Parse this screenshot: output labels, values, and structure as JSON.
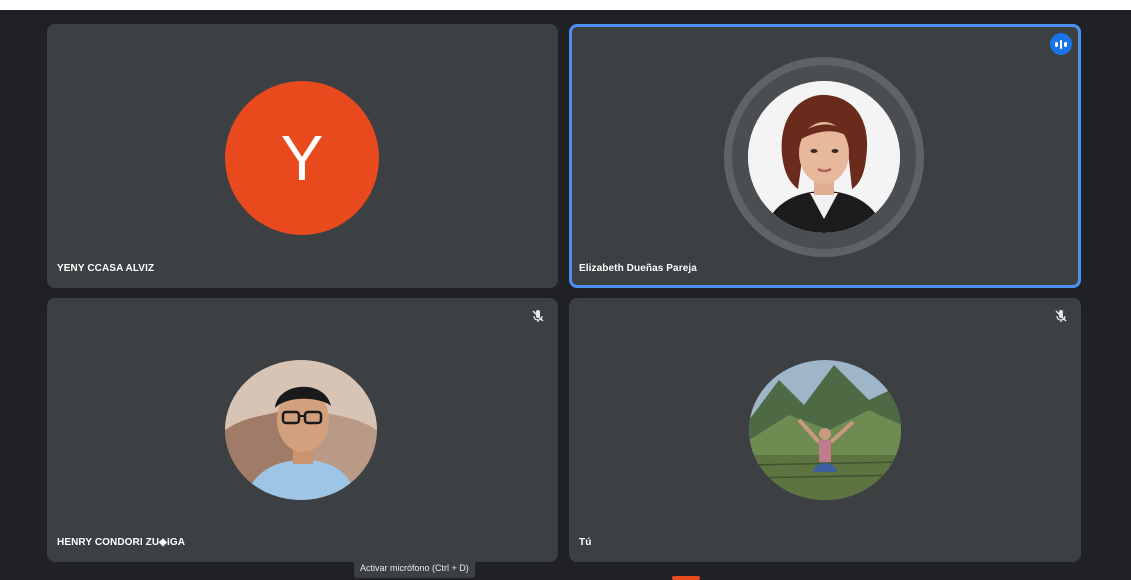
{
  "participants": [
    {
      "name": "YENY CCASA ALVIZ",
      "initial": "Y",
      "avatar_color": "#e8491d",
      "mic": "on"
    },
    {
      "name": "Elizabeth Dueñas Pareja",
      "speaking": true,
      "avatar": "portrait-woman-photo",
      "speaking_icon": "audio-level-icon"
    },
    {
      "name": "HENRY CONDORI ZU◆IGA",
      "mic": "muted",
      "avatar": "portrait-young-man-glasses-photo"
    },
    {
      "name": "Tú",
      "mic": "muted",
      "avatar": "person-arms-raised-mountains-photo"
    }
  ],
  "tooltip": {
    "text": "Activar micrófono (Ctrl + D)"
  },
  "colors": {
    "background": "#202124",
    "tile": "#3c4043",
    "speaking_border": "#4e8ff0",
    "badge": "#1a73e8"
  }
}
